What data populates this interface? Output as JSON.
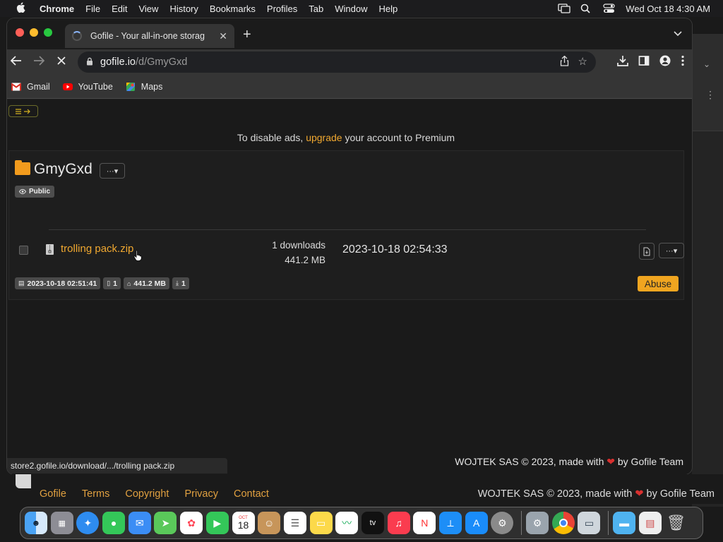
{
  "menubar": {
    "app": "Chrome",
    "items": [
      "File",
      "Edit",
      "View",
      "History",
      "Bookmarks",
      "Profiles",
      "Tab",
      "Window",
      "Help"
    ],
    "clock": "Wed Oct 18  4:30 AM"
  },
  "browser": {
    "tab_title": "Gofile - Your all-in-one storag",
    "url_host": "gofile.io",
    "url_path": "/d/GmyGxd",
    "bookmarks": [
      "Gmail",
      "YouTube",
      "Maps"
    ]
  },
  "page": {
    "ad_prefix": "To disable ads, ",
    "ad_link": "upgrade",
    "ad_suffix": " your account to Premium",
    "folder_name": "GmyGxd",
    "folder_menu": "···▾",
    "public_badge": "Public",
    "file": {
      "name": "trolling pack.zip",
      "downloads": "1 downloads",
      "size": "441.2 MB",
      "date": "2023-10-18 02:54:33"
    },
    "meta": {
      "created": "2023-10-18 02:51:41",
      "files": "1",
      "total_size": "441.2 MB",
      "total_downloads": "1"
    },
    "abuse_label": "Abuse",
    "status_url": "store2.gofile.io/download/.../trolling pack.zip",
    "footer_prefix": "WOJTEK SAS © 2023, made with ",
    "footer_suffix": " by Gofile Team"
  },
  "bottom": {
    "links": [
      "Gofile",
      "Terms",
      "Copyright",
      "Privacy",
      "Contact"
    ],
    "copy_prefix": "WOJTEK SAS © 2023, made with ",
    "copy_suffix": " by Gofile Team"
  },
  "dock": {
    "calendar_month": "OCT",
    "calendar_day": "18",
    "tv_label": "tv"
  },
  "colors": {
    "accent": "#f0a830",
    "heart": "#d9302f"
  }
}
